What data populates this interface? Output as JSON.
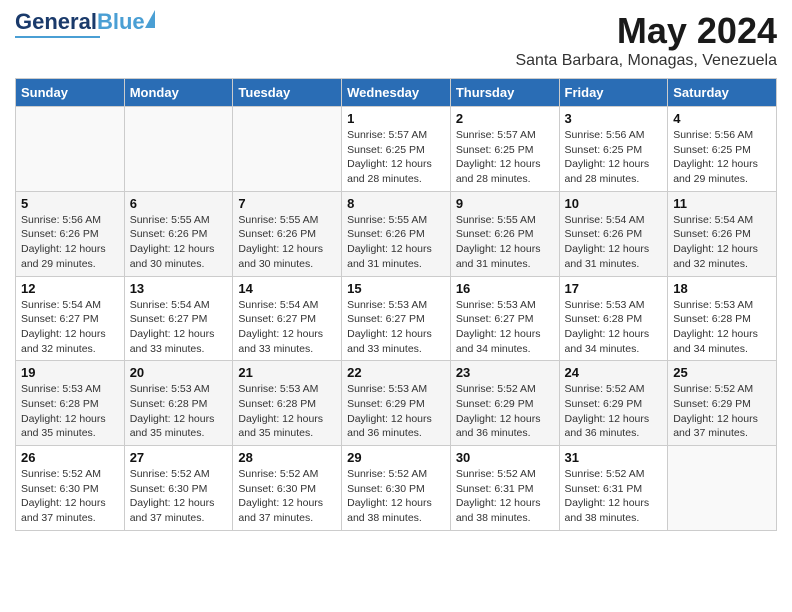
{
  "header": {
    "logo_line1": "General",
    "logo_line2": "Blue",
    "main_title": "May 2024",
    "subtitle": "Santa Barbara, Monagas, Venezuela"
  },
  "days_of_week": [
    "Sunday",
    "Monday",
    "Tuesday",
    "Wednesday",
    "Thursday",
    "Friday",
    "Saturday"
  ],
  "weeks": [
    [
      {
        "num": "",
        "info": ""
      },
      {
        "num": "",
        "info": ""
      },
      {
        "num": "",
        "info": ""
      },
      {
        "num": "1",
        "info": "Sunrise: 5:57 AM\nSunset: 6:25 PM\nDaylight: 12 hours\nand 28 minutes."
      },
      {
        "num": "2",
        "info": "Sunrise: 5:57 AM\nSunset: 6:25 PM\nDaylight: 12 hours\nand 28 minutes."
      },
      {
        "num": "3",
        "info": "Sunrise: 5:56 AM\nSunset: 6:25 PM\nDaylight: 12 hours\nand 28 minutes."
      },
      {
        "num": "4",
        "info": "Sunrise: 5:56 AM\nSunset: 6:25 PM\nDaylight: 12 hours\nand 29 minutes."
      }
    ],
    [
      {
        "num": "5",
        "info": "Sunrise: 5:56 AM\nSunset: 6:26 PM\nDaylight: 12 hours\nand 29 minutes."
      },
      {
        "num": "6",
        "info": "Sunrise: 5:55 AM\nSunset: 6:26 PM\nDaylight: 12 hours\nand 30 minutes."
      },
      {
        "num": "7",
        "info": "Sunrise: 5:55 AM\nSunset: 6:26 PM\nDaylight: 12 hours\nand 30 minutes."
      },
      {
        "num": "8",
        "info": "Sunrise: 5:55 AM\nSunset: 6:26 PM\nDaylight: 12 hours\nand 31 minutes."
      },
      {
        "num": "9",
        "info": "Sunrise: 5:55 AM\nSunset: 6:26 PM\nDaylight: 12 hours\nand 31 minutes."
      },
      {
        "num": "10",
        "info": "Sunrise: 5:54 AM\nSunset: 6:26 PM\nDaylight: 12 hours\nand 31 minutes."
      },
      {
        "num": "11",
        "info": "Sunrise: 5:54 AM\nSunset: 6:26 PM\nDaylight: 12 hours\nand 32 minutes."
      }
    ],
    [
      {
        "num": "12",
        "info": "Sunrise: 5:54 AM\nSunset: 6:27 PM\nDaylight: 12 hours\nand 32 minutes."
      },
      {
        "num": "13",
        "info": "Sunrise: 5:54 AM\nSunset: 6:27 PM\nDaylight: 12 hours\nand 33 minutes."
      },
      {
        "num": "14",
        "info": "Sunrise: 5:54 AM\nSunset: 6:27 PM\nDaylight: 12 hours\nand 33 minutes."
      },
      {
        "num": "15",
        "info": "Sunrise: 5:53 AM\nSunset: 6:27 PM\nDaylight: 12 hours\nand 33 minutes."
      },
      {
        "num": "16",
        "info": "Sunrise: 5:53 AM\nSunset: 6:27 PM\nDaylight: 12 hours\nand 34 minutes."
      },
      {
        "num": "17",
        "info": "Sunrise: 5:53 AM\nSunset: 6:28 PM\nDaylight: 12 hours\nand 34 minutes."
      },
      {
        "num": "18",
        "info": "Sunrise: 5:53 AM\nSunset: 6:28 PM\nDaylight: 12 hours\nand 34 minutes."
      }
    ],
    [
      {
        "num": "19",
        "info": "Sunrise: 5:53 AM\nSunset: 6:28 PM\nDaylight: 12 hours\nand 35 minutes."
      },
      {
        "num": "20",
        "info": "Sunrise: 5:53 AM\nSunset: 6:28 PM\nDaylight: 12 hours\nand 35 minutes."
      },
      {
        "num": "21",
        "info": "Sunrise: 5:53 AM\nSunset: 6:28 PM\nDaylight: 12 hours\nand 35 minutes."
      },
      {
        "num": "22",
        "info": "Sunrise: 5:53 AM\nSunset: 6:29 PM\nDaylight: 12 hours\nand 36 minutes."
      },
      {
        "num": "23",
        "info": "Sunrise: 5:52 AM\nSunset: 6:29 PM\nDaylight: 12 hours\nand 36 minutes."
      },
      {
        "num": "24",
        "info": "Sunrise: 5:52 AM\nSunset: 6:29 PM\nDaylight: 12 hours\nand 36 minutes."
      },
      {
        "num": "25",
        "info": "Sunrise: 5:52 AM\nSunset: 6:29 PM\nDaylight: 12 hours\nand 37 minutes."
      }
    ],
    [
      {
        "num": "26",
        "info": "Sunrise: 5:52 AM\nSunset: 6:30 PM\nDaylight: 12 hours\nand 37 minutes."
      },
      {
        "num": "27",
        "info": "Sunrise: 5:52 AM\nSunset: 6:30 PM\nDaylight: 12 hours\nand 37 minutes."
      },
      {
        "num": "28",
        "info": "Sunrise: 5:52 AM\nSunset: 6:30 PM\nDaylight: 12 hours\nand 37 minutes."
      },
      {
        "num": "29",
        "info": "Sunrise: 5:52 AM\nSunset: 6:30 PM\nDaylight: 12 hours\nand 38 minutes."
      },
      {
        "num": "30",
        "info": "Sunrise: 5:52 AM\nSunset: 6:31 PM\nDaylight: 12 hours\nand 38 minutes."
      },
      {
        "num": "31",
        "info": "Sunrise: 5:52 AM\nSunset: 6:31 PM\nDaylight: 12 hours\nand 38 minutes."
      },
      {
        "num": "",
        "info": ""
      }
    ]
  ]
}
